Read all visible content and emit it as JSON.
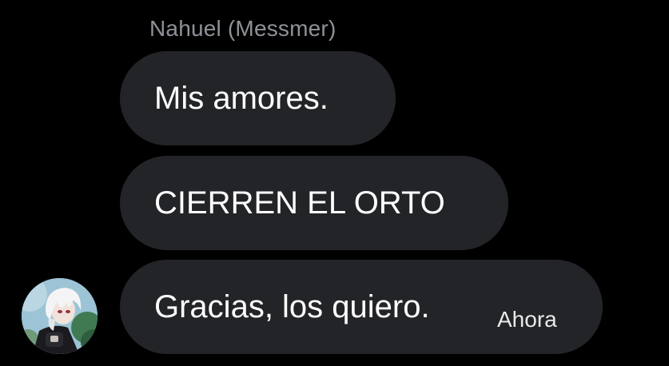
{
  "conversation": {
    "sender_name": "Nahuel (Messmer)",
    "messages": [
      {
        "text": "Mis amores."
      },
      {
        "text": "CIERREN EL ORTO"
      },
      {
        "text": "Gracias, los quiero.",
        "timestamp": "Ahora"
      }
    ]
  },
  "colors": {
    "background": "#000000",
    "bubble": "#232428",
    "message_text": "#ffffff",
    "sender_text": "#8e9297"
  },
  "icons": {
    "avatar": "sender-avatar-anime-character"
  }
}
